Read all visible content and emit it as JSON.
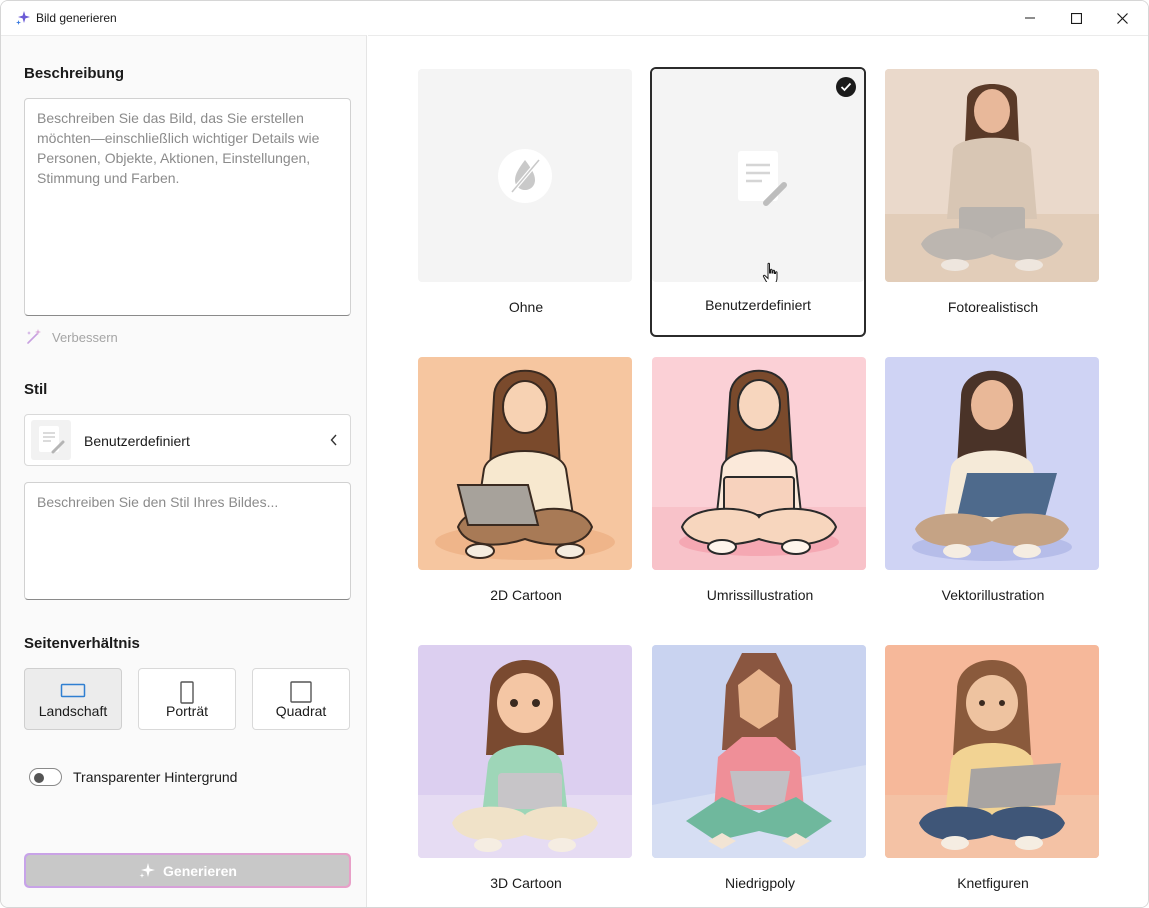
{
  "window": {
    "title": "Bild generieren",
    "controls": {
      "minimize": "minimize-icon",
      "maximize": "maximize-icon",
      "close": "close-icon"
    }
  },
  "left_panel": {
    "description": {
      "label": "Beschreibung",
      "placeholder": "Beschreiben Sie das Bild, das Sie erstellen möchten—einschließlich wichtiger Details wie Personen, Objekte, Aktionen, Einstellungen, Stimmung und Farben.",
      "enhance_label": "Verbessern"
    },
    "style": {
      "label": "Stil",
      "selected": "Benutzerdefiniert",
      "prompt_placeholder": "Beschreiben Sie den Stil Ihres Bildes..."
    },
    "aspect_ratio": {
      "label": "Seitenverhältnis",
      "options": [
        "Landschaft",
        "Porträt",
        "Quadrat"
      ],
      "selected": "Landschaft"
    },
    "transparent_background": {
      "label": "Transparenter Hintergrund",
      "enabled": false
    },
    "generate_label": "Generieren"
  },
  "styles": [
    {
      "label": "Ohne",
      "selected": false
    },
    {
      "label": "Benutzerdefiniert",
      "selected": true
    },
    {
      "label": "Fotorealistisch",
      "selected": false
    },
    {
      "label": "2D Cartoon",
      "selected": false
    },
    {
      "label": "Umrissillustration",
      "selected": false
    },
    {
      "label": "Vektorillustration",
      "selected": false
    },
    {
      "label": "3D Cartoon",
      "selected": false
    },
    {
      "label": "Niedrigpoly",
      "selected": false
    },
    {
      "label": "Knetfiguren",
      "selected": false
    }
  ],
  "colors": {
    "accent_gradient": [
      "#c7a3e9",
      "#e8a0c8"
    ],
    "selected_border": "#2b2b2b",
    "aspect_icon_active": "#2f7fd1"
  }
}
